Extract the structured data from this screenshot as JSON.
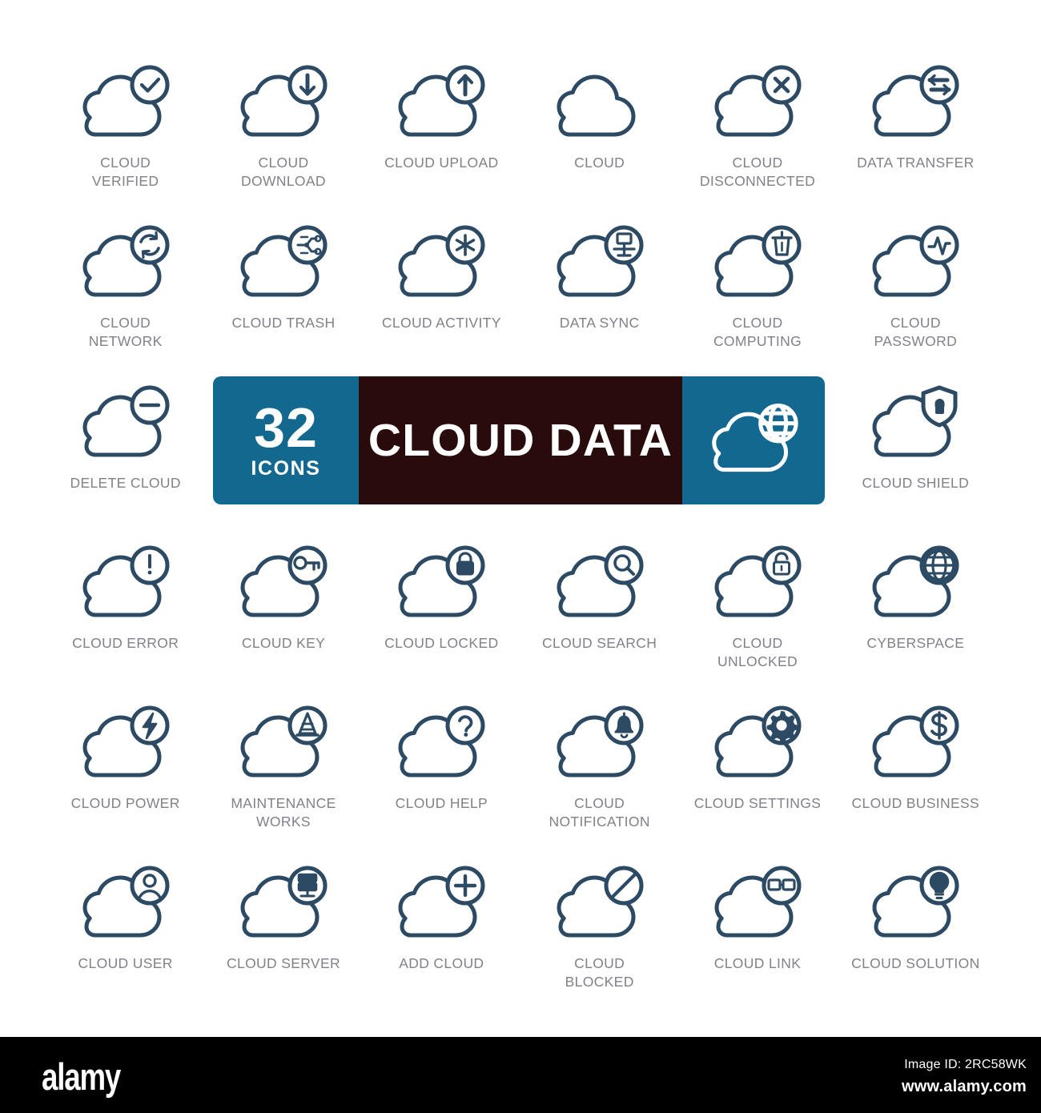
{
  "colors": {
    "icon_stroke": "#2C4A63",
    "label_text": "#808289",
    "accent_blue": "#12688F",
    "banner_dark": "#2A0B0B",
    "background": "#FFFFFF",
    "footer_bg": "#000000"
  },
  "banner": {
    "count": "32",
    "count_label": "ICONS",
    "title": "CLOUD DATA",
    "art_icon": "cloud-globe-icon"
  },
  "icons": [
    {
      "label": "CLOUD\nVERIFIED",
      "badge": "check-icon",
      "name": "cloud-verified"
    },
    {
      "label": "CLOUD\nDOWNLOAD",
      "badge": "arrow-down-icon",
      "name": "cloud-download"
    },
    {
      "label": "CLOUD UPLOAD",
      "badge": "arrow-up-icon",
      "name": "cloud-upload"
    },
    {
      "label": "CLOUD",
      "badge": "none",
      "name": "cloud"
    },
    {
      "label": "CLOUD\nDISCONNECTED",
      "badge": "x-icon",
      "name": "cloud-disconnected"
    },
    {
      "label": "DATA TRANSFER",
      "badge": "arrows-lr-icon",
      "name": "data-transfer"
    },
    {
      "label": "CLOUD\nNETWORK",
      "badge": "refresh-icon",
      "name": "cloud-network"
    },
    {
      "label": "CLOUD TRASH",
      "badge": "circuit-icon",
      "name": "cloud-trash"
    },
    {
      "label": "CLOUD ACTIVITY",
      "badge": "asterisk-icon",
      "name": "cloud-activity"
    },
    {
      "label": "DATA SYNC",
      "badge": "sitemap-icon",
      "name": "data-sync"
    },
    {
      "label": "CLOUD\nCOMPUTING",
      "badge": "trash-icon",
      "name": "cloud-computing"
    },
    {
      "label": "CLOUD\nPASSWORD",
      "badge": "pulse-icon",
      "name": "cloud-password"
    },
    {
      "label": "DELETE CLOUD",
      "badge": "minus-icon",
      "name": "delete-cloud"
    },
    {
      "label": "",
      "badge": "none",
      "name": "banner-slot-left"
    },
    {
      "label": "",
      "badge": "none",
      "name": "banner-slot-mid-a"
    },
    {
      "label": "",
      "badge": "none",
      "name": "banner-slot-mid-b"
    },
    {
      "label": "",
      "badge": "none",
      "name": "banner-slot-right"
    },
    {
      "label": "CLOUD SHIELD",
      "badge": "shield-lock-icon",
      "name": "cloud-shield"
    },
    {
      "label": "CLOUD ERROR",
      "badge": "exclamation-icon",
      "name": "cloud-error"
    },
    {
      "label": "CLOUD KEY",
      "badge": "key-icon",
      "name": "cloud-key"
    },
    {
      "label": "CLOUD LOCKED",
      "badge": "lock-closed-icon",
      "name": "cloud-locked"
    },
    {
      "label": "CLOUD SEARCH",
      "badge": "magnifier-icon",
      "name": "cloud-search"
    },
    {
      "label": "CLOUD\nUNLOCKED",
      "badge": "lock-open-icon",
      "name": "cloud-unlocked"
    },
    {
      "label": "CYBERSPACE",
      "badge": "globe-icon",
      "name": "cyberspace"
    },
    {
      "label": "CLOUD POWER",
      "badge": "bolt-icon",
      "name": "cloud-power"
    },
    {
      "label": "MAINTENANCE\nWORKS",
      "badge": "traffic-cone-icon",
      "name": "maintenance-works"
    },
    {
      "label": "CLOUD HELP",
      "badge": "question-icon",
      "name": "cloud-help"
    },
    {
      "label": "CLOUD\nNOTIFICATION",
      "badge": "bell-icon",
      "name": "cloud-notification"
    },
    {
      "label": "CLOUD SETTINGS",
      "badge": "gear-icon",
      "name": "cloud-settings"
    },
    {
      "label": "CLOUD BUSINESS",
      "badge": "dollar-icon",
      "name": "cloud-business"
    },
    {
      "label": "CLOUD USER",
      "badge": "user-icon",
      "name": "cloud-user"
    },
    {
      "label": "CLOUD SERVER",
      "badge": "server-icon",
      "name": "cloud-server"
    },
    {
      "label": "ADD CLOUD",
      "badge": "plus-icon",
      "name": "add-cloud"
    },
    {
      "label": "CLOUD\nBLOCKED",
      "badge": "slash-circle-icon",
      "name": "cloud-blocked"
    },
    {
      "label": "CLOUD LINK",
      "badge": "link-icon",
      "name": "cloud-link"
    },
    {
      "label": "CLOUD SOLUTION",
      "badge": "lightbulb-icon",
      "name": "cloud-solution"
    }
  ],
  "footer": {
    "logo": "alamy",
    "image_id": "Image ID: 2RC58WK",
    "url": "www.alamy.com"
  }
}
